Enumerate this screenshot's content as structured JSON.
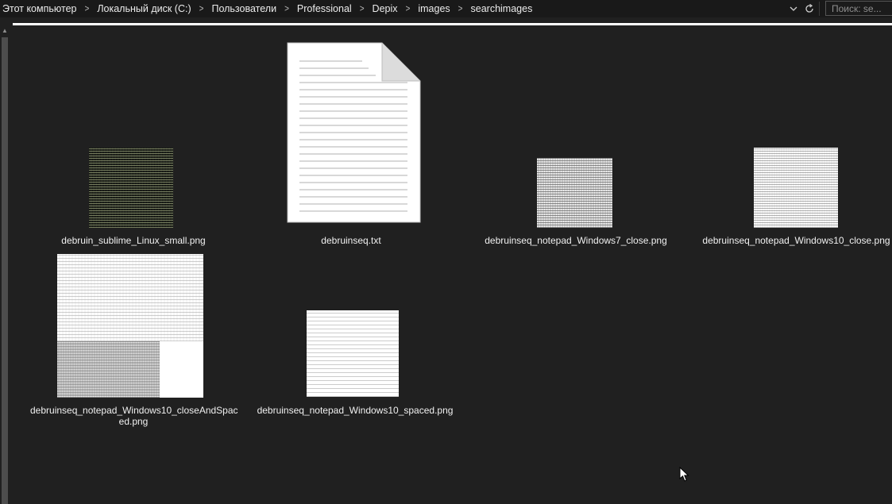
{
  "breadcrumb": {
    "items": [
      "Этот компьютер",
      "Локальный диск (C:)",
      "Пользователи",
      "Professional",
      "Depix",
      "images",
      "searchimages"
    ]
  },
  "address_controls": {
    "dropdown_icon": "chevron-down-icon",
    "refresh_icon": "refresh-icon"
  },
  "search": {
    "placeholder": "Поиск: se..."
  },
  "files": [
    {
      "name": "debruin_sublime_Linux_small.png",
      "kind": "image"
    },
    {
      "name": "debruinseq.txt",
      "kind": "text-document"
    },
    {
      "name": "debruinseq_notepad_Windows7_close.png",
      "kind": "image"
    },
    {
      "name": "debruinseq_notepad_Windows10_close.png",
      "kind": "image"
    },
    {
      "name": "debruinseq_notepad_Windows10_closeAndSpaced.png",
      "label_lines": [
        "debruinseq_notepad_Windows10_closeAndSpac",
        "ed.png"
      ],
      "kind": "image"
    },
    {
      "name": "debruinseq_notepad_Windows10_spaced.png",
      "kind": "image"
    }
  ],
  "colors": {
    "background": "#202020",
    "topbar": "#191919",
    "text": "#f0f0f0"
  }
}
